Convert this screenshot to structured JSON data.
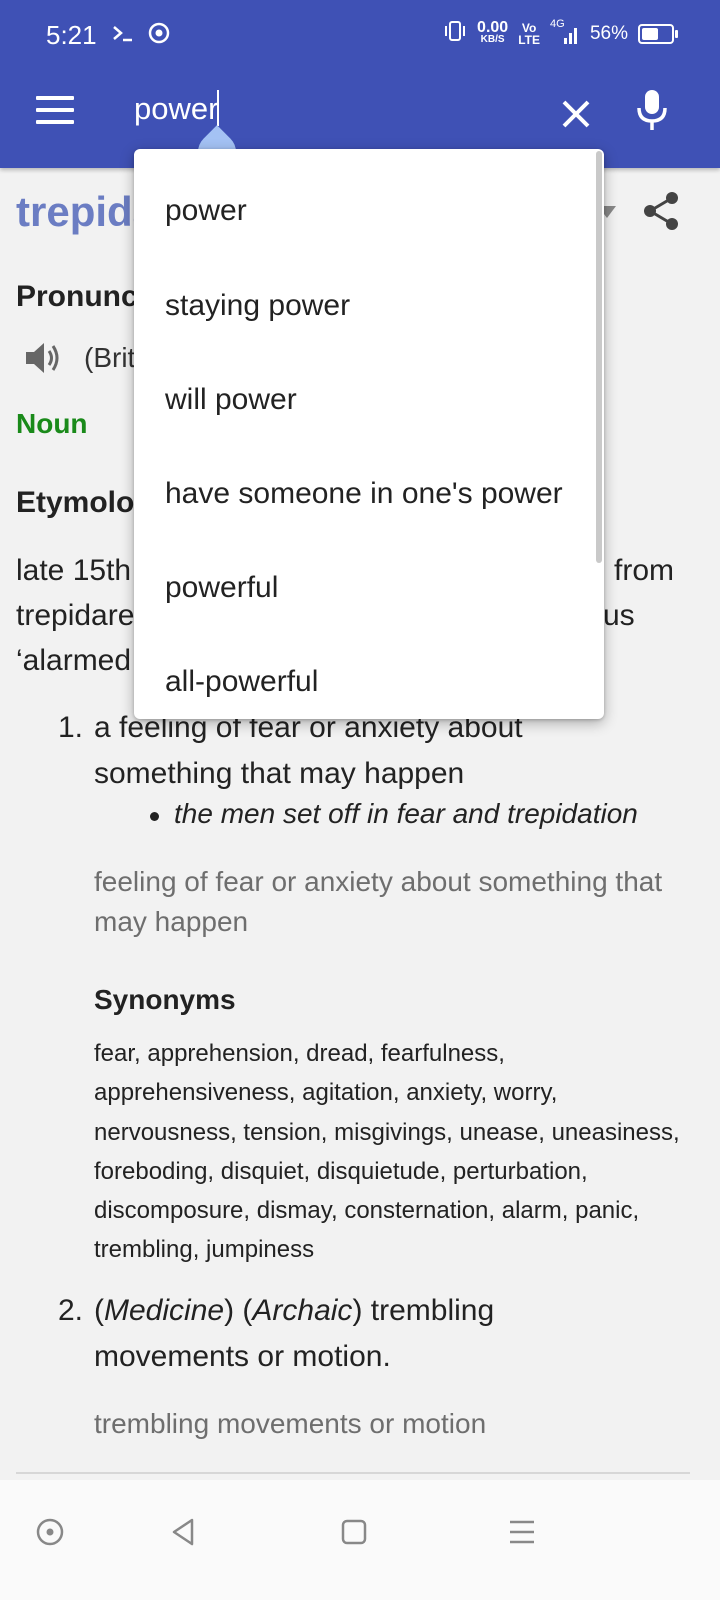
{
  "status_bar": {
    "time": "5:21",
    "net_speed_value": "0.00",
    "net_speed_unit": "KB/S",
    "volte": "Vo",
    "lte": "LTE",
    "network": "4G",
    "battery": "56%"
  },
  "search": {
    "query": "power",
    "placeholder": ""
  },
  "suggestions": [
    "power",
    "staying power",
    "will power",
    "have someone in one's power",
    "powerful",
    "all-powerful"
  ],
  "entry": {
    "headword": "trepida",
    "pronunciation_heading": "Pronunc",
    "pronunciation_text": "(Brit",
    "part_of_speech": "Noun",
    "etymology_heading": "Etymolo",
    "etymology_lines": [
      {
        "left": "late 15th",
        "right": "from"
      },
      {
        "left": "trepidare",
        "right": "us"
      },
      {
        "left": "‘alarmed",
        "right": ""
      }
    ],
    "senses": [
      {
        "number": "1.",
        "definition": "a feeling of fear or anxiety about something that may happen",
        "example": "the men set off in fear and trepidation",
        "gloss": "feeling of fear or anxiety about something that may happen",
        "synonyms_heading": "Synonyms",
        "synonyms": "fear, apprehension, dread, fearfulness, apprehensiveness, agitation, anxiety, worry, nervousness, tension, misgivings, unease, uneasiness, foreboding, disquiet, disquietude, perturbation, discomposure, dismay, consternation, alarm, panic, trembling, jumpiness"
      },
      {
        "number": "2.",
        "label1": "Medicine",
        "label2": "Archaic",
        "definition": "trembling movements or motion.",
        "gloss": "trembling movements or motion"
      }
    ]
  },
  "colors": {
    "app_bar": "#3f51b5",
    "headword": "#6b7dc3",
    "part_of_speech": "#1a8a1a",
    "caret_drop": "#a4c2f4"
  }
}
